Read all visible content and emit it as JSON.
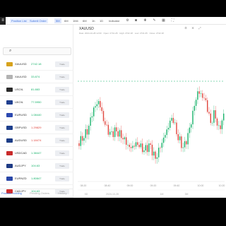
{
  "topbar": {
    "logo": "≡",
    "buttons": [
      "Position List",
      "Submit Order"
    ],
    "intervals": [
      "5M",
      "6M",
      "1M4",
      "6M",
      "1h",
      "1D"
    ],
    "active_interval": "5M",
    "indicator_label": "Indicator"
  },
  "search": {
    "placeholder": ""
  },
  "symbols": [
    {
      "name": "XAUUSD",
      "price": "2742.18",
      "dir": "up",
      "flag": "#d7a21c",
      "trade": "Trade"
    },
    {
      "name": "XAUUSD",
      "price": "33.874",
      "dir": "up",
      "flag": "#b3b3b3",
      "trade": "Trade"
    },
    {
      "name": "USOIL",
      "price": "81.883",
      "dir": "up",
      "flag": "#2a2a2a",
      "trade": "Trade"
    },
    {
      "name": "UKOIL",
      "price": "77.5950",
      "dir": "up",
      "flag": "#1f3f8f",
      "trade": "Trade"
    },
    {
      "name": "EURUSD",
      "price": "1.08440",
      "dir": "up",
      "flag": "#2c49b0",
      "trade": "Trade"
    },
    {
      "name": "GBPUSD",
      "price": "1.29829",
      "dir": "down",
      "flag": "#1d3f8c",
      "trade": "Trade"
    },
    {
      "name": "AUDUSD",
      "price": "1.18474",
      "dir": "down",
      "flag": "#1b3c86",
      "trade": "Trade"
    },
    {
      "name": "USDCAD",
      "price": "1.38447",
      "dir": "up",
      "flag": "#c92a2a",
      "trade": "Trade"
    },
    {
      "name": "AUDJPY",
      "price": "104.63",
      "dir": "up",
      "flag": "#1f3b85",
      "trade": "Trade"
    },
    {
      "name": "EURNZD",
      "price": "1.80847",
      "dir": "up",
      "flag": "#2a47a8",
      "trade": "Trade"
    },
    {
      "name": "CADJPY",
      "price": "104.63",
      "dir": "up",
      "flag": "#d22d2d",
      "trade": "Trade"
    }
  ],
  "bottom_tabs": [
    "Position Holding",
    "Pending Orders",
    "History"
  ],
  "chart_header": {
    "symbol": "XAUUSD",
    "ohlc": [
      "Date: 2024-10-28 12:00",
      "Open: 2741.28",
      "High: 2742.18",
      "Low: 2741.05",
      "Close: 2742.18"
    ]
  },
  "chart_data": {
    "type": "candlestick",
    "xlabels": [
      "08:20",
      "08:40",
      "09:00",
      "09:20",
      "09:40",
      "10:00",
      "10:20"
    ],
    "bottom_labels": [
      "5D",
      "2024-10-28",
      "1M",
      "3M"
    ],
    "up_color": "#17b26a",
    "down_color": "#e0443c",
    "dashed_level_color": "#17b26a"
  }
}
